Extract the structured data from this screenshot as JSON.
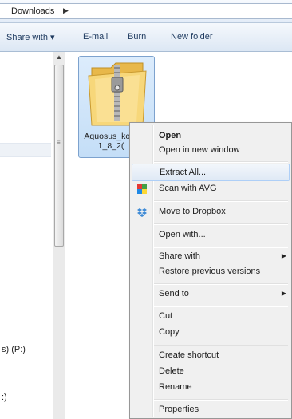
{
  "breadcrumb": {
    "label": "Downloads",
    "arrow": "▶"
  },
  "toolbar": {
    "share_with": "Share with ▾",
    "email": "E-mail",
    "burn": "Burn",
    "new_folder": "New folder"
  },
  "nav": {
    "drive_p": "s) (P:)",
    "drive_other": ":)"
  },
  "file": {
    "name": "Aquosus_kor_1_8_2("
  },
  "context_menu": {
    "open": "Open",
    "open_new_window": "Open in new window",
    "extract_all": "Extract All...",
    "scan_avg": "Scan with AVG",
    "move_dropbox": "Move to Dropbox",
    "open_with": "Open with...",
    "share_with": "Share with",
    "restore_versions": "Restore previous versions",
    "send_to": "Send to",
    "cut": "Cut",
    "copy": "Copy",
    "create_shortcut": "Create shortcut",
    "delete": "Delete",
    "rename": "Rename",
    "properties": "Properties",
    "submenu_arrow": "▶"
  },
  "colors": {
    "menu_background": "#f0f0f0",
    "hover_highlight": "#dfe9f5",
    "selection_fill": "#c4def7"
  },
  "icons": {
    "avg": "avg-icon",
    "dropbox": "dropbox-icon",
    "zip_folder": "zip-folder-icon"
  }
}
